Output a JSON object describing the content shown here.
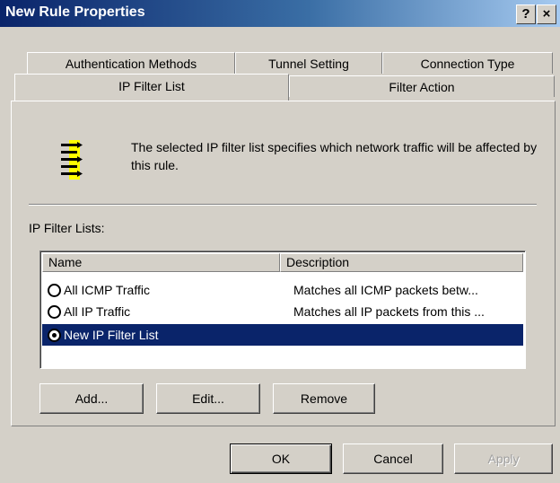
{
  "window": {
    "title": "New Rule Properties",
    "help_label": "?",
    "close_label": "×"
  },
  "tabs": {
    "row_back": [
      "Authentication Methods",
      "Tunnel Setting",
      "Connection Type"
    ],
    "active": "IP Filter List",
    "filter_action": "Filter Action"
  },
  "description": {
    "text": "The selected IP filter list specifies which network traffic will be affected by this rule.",
    "icon": "filter-list-icon"
  },
  "filter_lists": {
    "label": "IP Filter Lists:",
    "columns": [
      "Name",
      "Description"
    ],
    "rows": [
      {
        "name": "All ICMP Traffic",
        "description": "Matches all ICMP packets betw...",
        "checked": false,
        "selected": false
      },
      {
        "name": "All IP Traffic",
        "description": "Matches all IP packets from this ...",
        "checked": false,
        "selected": false
      },
      {
        "name": "New IP Filter List",
        "description": "",
        "checked": true,
        "selected": true
      }
    ]
  },
  "list_buttons": {
    "add": "Add...",
    "edit": "Edit...",
    "remove": "Remove"
  },
  "dialog_buttons": {
    "ok": "OK",
    "cancel": "Cancel",
    "apply": "Apply"
  },
  "colors": {
    "selection": "#0a246a",
    "face": "#d4d0c8",
    "title_start": "#0a246a",
    "title_end": "#a6caf0"
  }
}
